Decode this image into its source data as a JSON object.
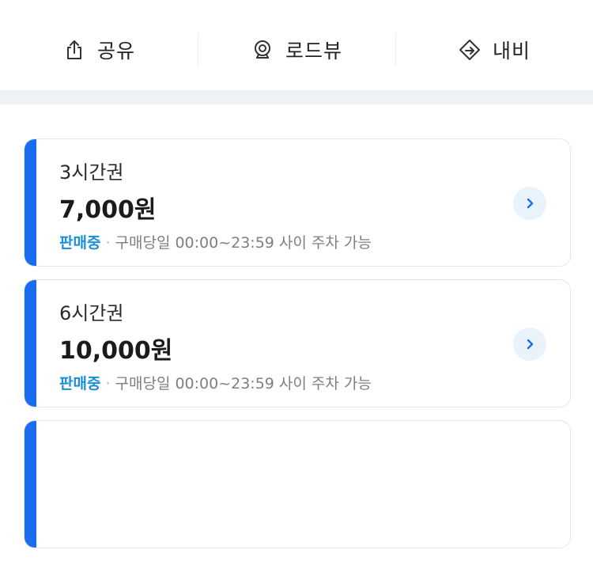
{
  "actions": [
    {
      "label": "공유",
      "icon": "share-icon"
    },
    {
      "label": "로드뷰",
      "icon": "roadview-icon"
    },
    {
      "label": "내비",
      "icon": "navigation-icon"
    }
  ],
  "tickets": [
    {
      "name": "3시간권",
      "price": "7,000원",
      "status": "판매중",
      "separator": "·",
      "detail": "구매당일 00:00~23:59 사이 주차 가능"
    },
    {
      "name": "6시간권",
      "price": "10,000원",
      "status": "판매중",
      "separator": "·",
      "detail": "구매당일 00:00~23:59 사이 주차 가능"
    }
  ],
  "colors": {
    "accent": "#1a6df0",
    "status": "#1b8fd8",
    "arrow_bg": "#e8f3fc",
    "band": "#eef2f6"
  }
}
